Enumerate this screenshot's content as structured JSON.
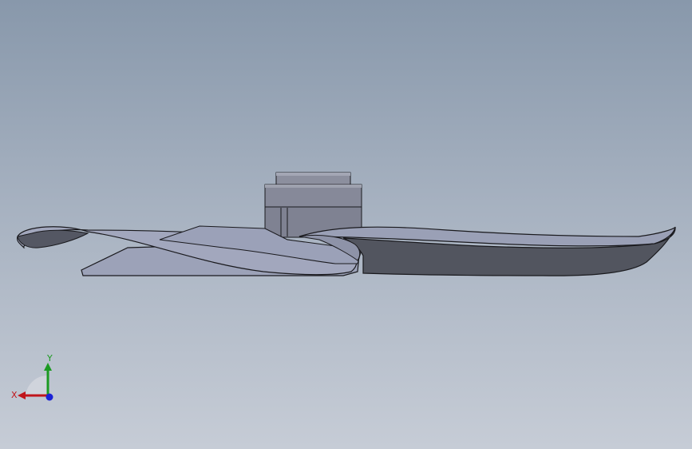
{
  "triad": {
    "x_label": "X",
    "y_label": "Y",
    "colors": {
      "x_axis": "#c0151b",
      "y_axis": "#1c9a22",
      "z_axis": "#1a22d6"
    }
  },
  "scene": {
    "model_icon": "propeller-fan-icon",
    "view": "front",
    "colors": {
      "background_top": "#8898ab",
      "background_bottom": "#c6ccd6",
      "blade_face": "#9aa0b5",
      "blade_dark": "#51545f",
      "hub": "#8a8d9c",
      "edge": "#1a1a1e"
    }
  }
}
